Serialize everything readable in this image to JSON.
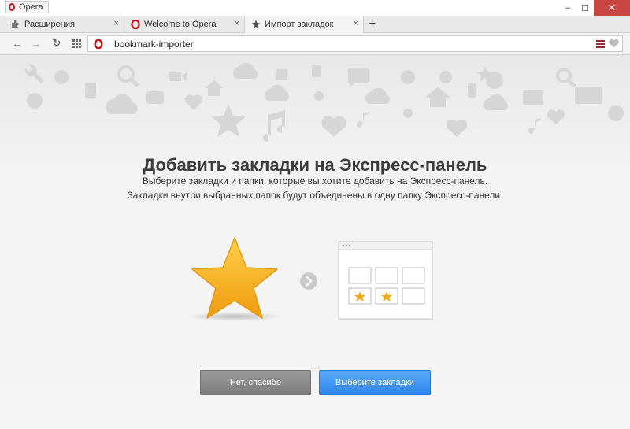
{
  "window": {
    "app_name": "Opera",
    "minimize": "‒",
    "restore": "☐",
    "close": "✕"
  },
  "tabs": [
    {
      "label": "Расширения",
      "icon": "puzzle-icon",
      "close": "×"
    },
    {
      "label": "Welcome to Opera",
      "icon": "opera-icon",
      "close": "×"
    },
    {
      "label": "Импорт закладок",
      "icon": "star-icon",
      "close": "×"
    }
  ],
  "new_tab_label": "+",
  "toolbar": {
    "back": "←",
    "forward": "→",
    "reload": "↻",
    "address": "bookmark-importer"
  },
  "page": {
    "title": "Добавить закладки на Экспресс-панель",
    "subtitle_1": "Выберите закладки и папки, которые вы хотите добавить на Экспресс-панель.",
    "subtitle_2": "Закладки внутри выбранных папок будут объединены в одну папку Экспресс-панели."
  },
  "buttons": {
    "decline": "Нет, спасибо",
    "choose": "Выберите закладки"
  },
  "colors": {
    "accent_blue": "#3a90f0",
    "star_gold": "#f3a915",
    "opera_red": "#cc0f16"
  }
}
